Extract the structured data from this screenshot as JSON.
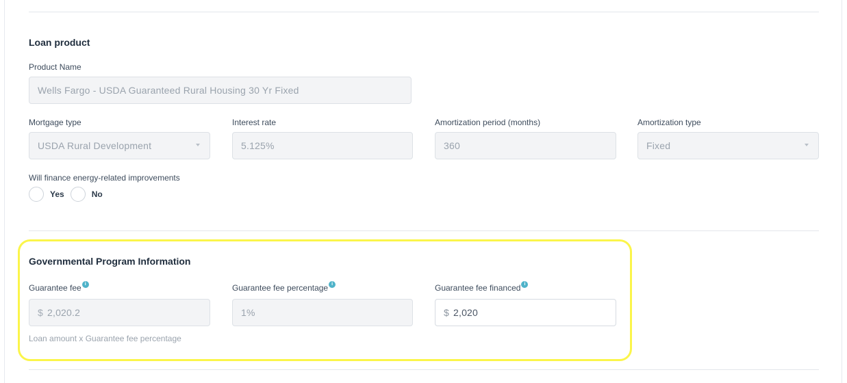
{
  "loan_product": {
    "title": "Loan product",
    "product_name": {
      "label": "Product Name",
      "value": "Wells Fargo -  USDA Guaranteed Rural Housing 30 Yr Fixed"
    },
    "mortgage_type": {
      "label": "Mortgage type",
      "value": "USDA Rural Development"
    },
    "interest_rate": {
      "label": "Interest rate",
      "value": "5.125%"
    },
    "amortization_period": {
      "label": "Amortization period (months)",
      "value": "360"
    },
    "amortization_type": {
      "label": "Amortization type",
      "value": "Fixed"
    },
    "energy_improvements": {
      "label": "Will finance energy-related improvements",
      "options": [
        "Yes",
        "No"
      ]
    }
  },
  "governmental_program": {
    "title": "Governmental Program Information",
    "guarantee_fee": {
      "label": "Guarantee fee",
      "prefix": "$",
      "value": "2,020.2",
      "hint": "Loan amount x Guarantee fee percentage"
    },
    "guarantee_fee_percentage": {
      "label": "Guarantee fee percentage",
      "value": "1%"
    },
    "guarantee_fee_financed": {
      "label": "Guarantee fee financed",
      "prefix": "$",
      "value": "2,020"
    }
  },
  "icons": {
    "info_glyph": "i"
  },
  "colors": {
    "highlight": "#fbf54a",
    "info_icon": "#4fb3c9",
    "readonly_field_bg": "#f3f4f6"
  }
}
